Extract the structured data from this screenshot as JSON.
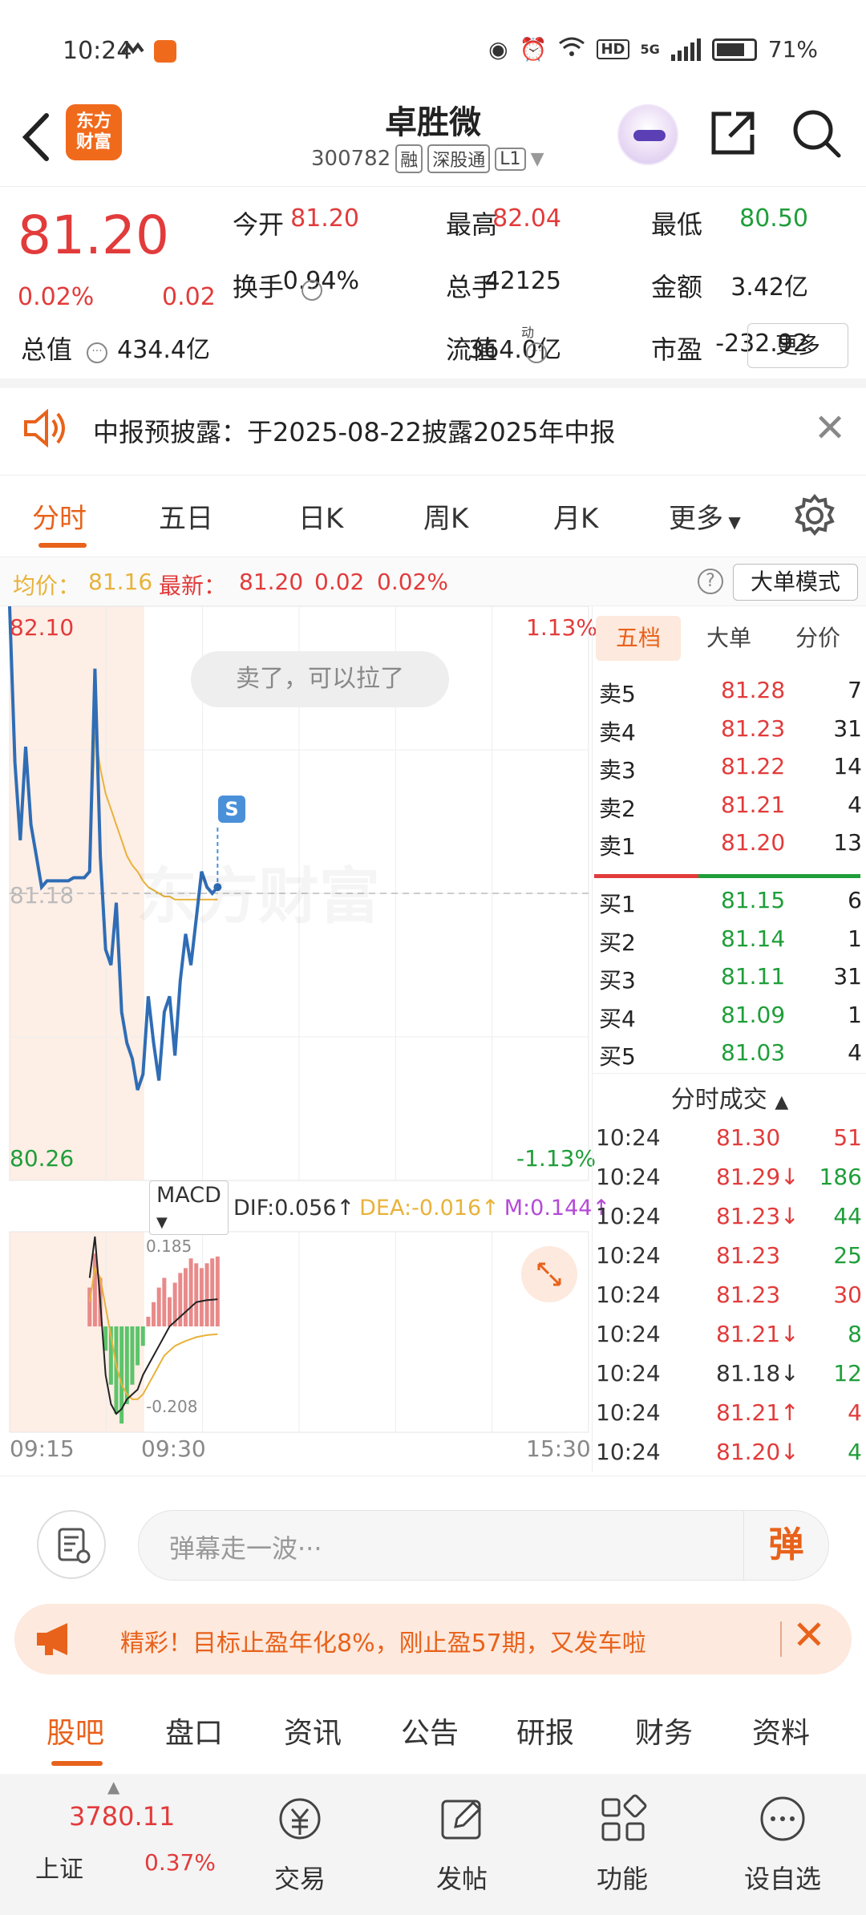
{
  "status_bar": {
    "time": "10:24",
    "battery": "71%",
    "network": "5G",
    "hd": "HD"
  },
  "header": {
    "logo_line1": "东方",
    "logo_line2": "财富",
    "title": "卓胜微",
    "code": "300782",
    "tags": [
      "融",
      "深股通",
      "L1"
    ]
  },
  "quote": {
    "price": "81.20",
    "change_pct": "0.02%",
    "change": "0.02",
    "fields": [
      {
        "label": "今开",
        "value": "81.20",
        "color": "#e23b3b"
      },
      {
        "label": "最高",
        "value": "82.04",
        "color": "#e23b3b"
      },
      {
        "label": "最低",
        "value": "80.50",
        "color": "#1f9e3a"
      },
      {
        "label": "换手",
        "value": "0.94%",
        "color": "#222222"
      },
      {
        "label": "总手",
        "value": "42125",
        "color": "#222222"
      },
      {
        "label": "金额",
        "value": "3.42亿",
        "color": "#222222"
      },
      {
        "label": "总值",
        "value": "434.4亿",
        "color": "#222222"
      },
      {
        "label": "流值",
        "value": "364.0亿",
        "color": "#222222"
      },
      {
        "label": "市盈",
        "value": "-232.92",
        "color": "#222222"
      }
    ],
    "pe_mark": "动",
    "more_label": "更多"
  },
  "notice": {
    "text": "中报预披露：于2025-08-22披露2025年中报"
  },
  "chart_tabs": {
    "items": [
      "分时",
      "五日",
      "日K",
      "周K",
      "月K",
      "更多"
    ],
    "active": 0
  },
  "avg_bar": {
    "avg_label": "均价：",
    "avg_value": "81.16",
    "latest_label": "最新：",
    "latest_value": "81.20",
    "latest_change": "0.02",
    "latest_pct": "0.02%",
    "mode_button": "大单模式"
  },
  "chart_labels": {
    "high_price": "82.10",
    "high_pct": "1.13%",
    "low_price": "80.26",
    "low_pct": "-1.13%",
    "ref_price": "81.18",
    "bubble": "卖了，可以拉了",
    "watermark": "东方财富",
    "signal": "S",
    "macd_select": "MACD",
    "dif": "DIF:0.056↑",
    "dea": "DEA:-0.016↑",
    "m": "M:0.144↑",
    "macd_top": "0.185",
    "macd_bottom": "-0.208",
    "t_start": "09:15",
    "t_open": "09:30",
    "t_end": "15:30"
  },
  "chart_data": {
    "type": "line",
    "title": "",
    "xlabel": "",
    "ylabel": "",
    "ylim": [
      80.26,
      82.1
    ],
    "x": [
      "09:15",
      "09:16",
      "09:17",
      "09:18",
      "09:19",
      "09:20",
      "09:21",
      "09:22",
      "09:23",
      "09:24",
      "09:25",
      "09:26",
      "09:27",
      "09:28",
      "09:29",
      "09:30",
      "09:31",
      "09:32",
      "09:33",
      "09:34",
      "09:35",
      "09:36",
      "09:37",
      "09:38",
      "09:39",
      "09:40",
      "09:41",
      "09:42",
      "09:43",
      "09:44",
      "09:45",
      "09:46",
      "09:47",
      "09:48",
      "09:49",
      "09:50",
      "09:51",
      "09:52",
      "09:53",
      "09:54"
    ],
    "series": [
      {
        "name": "价格",
        "color": "#2f6db5",
        "values": [
          82.1,
          81.6,
          81.35,
          81.65,
          81.4,
          81.3,
          81.2,
          81.22,
          81.22,
          81.22,
          81.22,
          81.22,
          81.23,
          81.23,
          81.23,
          81.25,
          81.9,
          81.3,
          81.0,
          80.95,
          81.15,
          80.8,
          80.7,
          80.65,
          80.55,
          80.6,
          80.85,
          80.7,
          80.58,
          80.8,
          80.85,
          80.66,
          80.9,
          81.05,
          80.95,
          81.1,
          81.25,
          81.2,
          81.18,
          81.2
        ]
      },
      {
        "name": "均价",
        "color": "#e8b23a",
        "values": [
          null,
          null,
          null,
          null,
          null,
          null,
          null,
          null,
          null,
          null,
          null,
          null,
          null,
          null,
          null,
          81.25,
          81.7,
          81.58,
          81.5,
          81.45,
          81.4,
          81.35,
          81.3,
          81.27,
          81.25,
          81.22,
          81.2,
          81.19,
          81.18,
          81.17,
          81.17,
          81.16,
          81.16,
          81.16,
          81.16,
          81.16,
          81.16,
          81.16,
          81.16,
          81.16
        ]
      }
    ],
    "macd": {
      "hist": [
        0,
        0,
        0,
        0,
        0,
        0,
        0,
        0,
        0,
        0,
        0,
        0,
        0,
        0,
        0,
        0.08,
        0.15,
        0.1,
        -0.05,
        -0.12,
        -0.18,
        -0.2,
        -0.16,
        -0.12,
        -0.08,
        -0.04,
        0.02,
        0.05,
        0.08,
        0.1,
        0.06,
        0.09,
        0.11,
        0.12,
        0.14,
        0.13,
        0.12,
        0.13,
        0.14,
        0.144
      ],
      "dif": [
        0,
        0,
        0,
        0,
        0,
        0,
        0,
        0,
        0,
        0,
        0,
        0,
        0,
        0,
        0,
        0.1,
        0.185,
        0.05,
        -0.1,
        -0.16,
        -0.18,
        -0.17,
        -0.15,
        -0.14,
        -0.13,
        -0.1,
        -0.08,
        -0.06,
        -0.04,
        -0.02,
        0.0,
        0.01,
        0.02,
        0.03,
        0.04,
        0.05,
        0.052,
        0.054,
        0.055,
        0.056
      ],
      "dea": [
        0,
        0,
        0,
        0,
        0,
        0,
        0,
        0,
        0,
        0,
        0,
        0,
        0,
        0,
        0,
        0.05,
        0.12,
        0.1,
        0.04,
        -0.02,
        -0.08,
        -0.12,
        -0.14,
        -0.15,
        -0.15,
        -0.14,
        -0.12,
        -0.1,
        -0.08,
        -0.06,
        -0.05,
        -0.04,
        -0.035,
        -0.03,
        -0.026,
        -0.022,
        -0.02,
        -0.018,
        -0.017,
        -0.016
      ]
    }
  },
  "order_book": {
    "tabs": [
      "五档",
      "大单",
      "分价"
    ],
    "asks": [
      {
        "label": "卖5",
        "price": "81.28",
        "vol": "7"
      },
      {
        "label": "卖4",
        "price": "81.23",
        "vol": "31"
      },
      {
        "label": "卖3",
        "price": "81.22",
        "vol": "14"
      },
      {
        "label": "卖2",
        "price": "81.21",
        "vol": "4"
      },
      {
        "label": "卖1",
        "price": "81.20",
        "vol": "13"
      }
    ],
    "bids": [
      {
        "label": "买1",
        "price": "81.15",
        "vol": "6"
      },
      {
        "label": "买2",
        "price": "81.14",
        "vol": "1"
      },
      {
        "label": "买3",
        "price": "81.11",
        "vol": "31"
      },
      {
        "label": "买4",
        "price": "81.09",
        "vol": "1"
      },
      {
        "label": "买5",
        "price": "81.03",
        "vol": "4"
      }
    ],
    "trades_title": "分时成交",
    "trades": [
      {
        "time": "10:24",
        "price": "81.30",
        "arrow": "",
        "vol": "51",
        "pcolor": "#e23b3b",
        "vcolor": "#e23b3b"
      },
      {
        "time": "10:24",
        "price": "81.29↓",
        "arrow": "",
        "vol": "186",
        "pcolor": "#e23b3b",
        "vcolor": "#1f9e3a"
      },
      {
        "time": "10:24",
        "price": "81.23↓",
        "arrow": "",
        "vol": "44",
        "pcolor": "#e23b3b",
        "vcolor": "#1f9e3a"
      },
      {
        "time": "10:24",
        "price": "81.23",
        "arrow": "",
        "vol": "25",
        "pcolor": "#e23b3b",
        "vcolor": "#1f9e3a"
      },
      {
        "time": "10:24",
        "price": "81.23",
        "arrow": "",
        "vol": "30",
        "pcolor": "#e23b3b",
        "vcolor": "#e23b3b"
      },
      {
        "time": "10:24",
        "price": "81.21↓",
        "arrow": "",
        "vol": "8",
        "pcolor": "#e23b3b",
        "vcolor": "#1f9e3a"
      },
      {
        "time": "10:24",
        "price": "81.18↓",
        "arrow": "",
        "vol": "12",
        "pcolor": "#333333",
        "vcolor": "#1f9e3a"
      },
      {
        "time": "10:24",
        "price": "81.21↑",
        "arrow": "",
        "vol": "4",
        "pcolor": "#e23b3b",
        "vcolor": "#e23b3b"
      },
      {
        "time": "10:24",
        "price": "81.20↓",
        "arrow": "",
        "vol": "4",
        "pcolor": "#e23b3b",
        "vcolor": "#1f9e3a"
      }
    ]
  },
  "input_bar": {
    "placeholder": "弹幕走一波···",
    "send_label": "弹"
  },
  "promo": {
    "text": "精彩！目标止盈年化8%，刚止盈57期，又发车啦"
  },
  "sub_nav": {
    "items": [
      "股吧",
      "盘口",
      "资讯",
      "公告",
      "研报",
      "财务",
      "资料"
    ],
    "active": 0
  },
  "bottom_nav": {
    "index_value": "3780.11",
    "index_name": "上证",
    "index_pct": "0.37%",
    "items": [
      "交易",
      "发帖",
      "功能",
      "设自选"
    ]
  },
  "colors": {
    "accent": "#e8621b",
    "up": "#e23b3b",
    "down": "#1f9e3a",
    "price_line": "#2f6db5",
    "avg_line": "#e8b23a"
  }
}
